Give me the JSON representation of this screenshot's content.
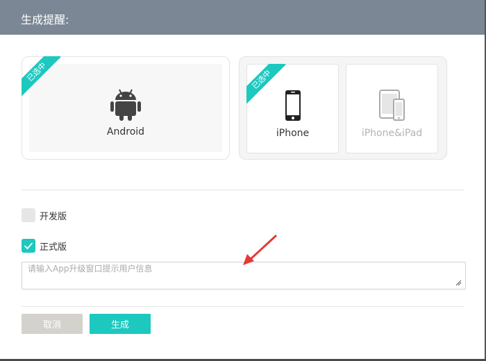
{
  "dialog": {
    "title": "生成提醒:",
    "selected_badge": "已选中"
  },
  "platforms": {
    "android": {
      "label": "Android",
      "selected": true,
      "icon": "android-icon"
    },
    "iphone": {
      "label": "iPhone",
      "selected": true,
      "icon": "iphone-icon"
    },
    "iphone_ipad": {
      "label": "iPhone&iPad",
      "selected": false,
      "icon": "iphone-ipad-icon"
    }
  },
  "versions": {
    "dev_label": "开发版",
    "dev_checked": false,
    "release_label": "正式版",
    "release_checked": true
  },
  "message": {
    "placeholder": "请输入App升级窗口提示用户信息",
    "value": ""
  },
  "buttons": {
    "cancel": "取消",
    "generate": "生成"
  },
  "colors": {
    "header": "#7b8794",
    "accent": "#1dc8bf",
    "cancel": "#d4d2cd",
    "annotation_arrow": "#e53935"
  }
}
